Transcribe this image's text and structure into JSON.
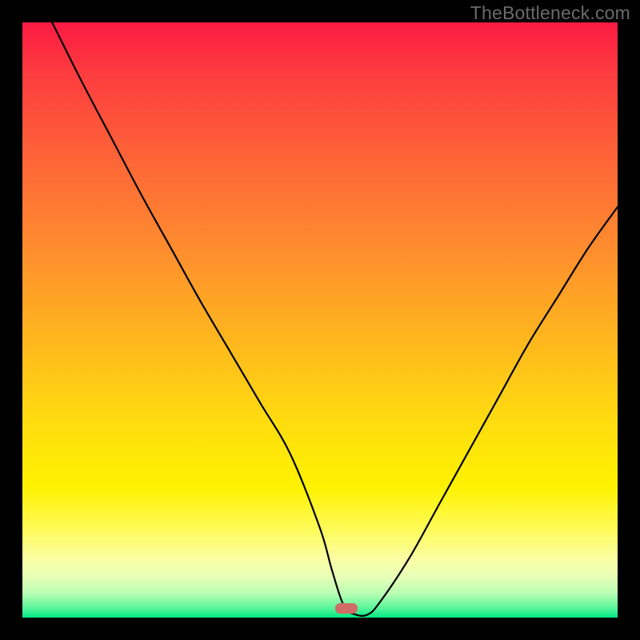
{
  "watermark": "TheBottleneck.com",
  "marker": {
    "x_pct": 54.5,
    "y_pct": 99.0
  },
  "chart_data": {
    "type": "line",
    "title": "",
    "xlabel": "",
    "ylabel": "",
    "xlim": [
      0,
      100
    ],
    "ylim": [
      0,
      100
    ],
    "grid": false,
    "annotations": [
      "TheBottleneck.com"
    ],
    "marker": {
      "x": 54.5,
      "y": 0.5
    },
    "series": [
      {
        "name": "bottleneck-curve",
        "x": [
          5,
          10,
          15,
          20,
          25,
          30,
          35,
          40,
          45,
          50,
          52,
          54,
          56,
          58,
          60,
          65,
          70,
          75,
          80,
          85,
          90,
          95,
          100
        ],
        "y": [
          100,
          90,
          80.5,
          71,
          62,
          53,
          44.5,
          36,
          27.5,
          15,
          8,
          2,
          0.5,
          0.5,
          2.5,
          10,
          19,
          28,
          37,
          46,
          54,
          62,
          69
        ]
      }
    ],
    "background_gradient_stops": [
      {
        "pos": 0.0,
        "color": "#fc1a44"
      },
      {
        "pos": 0.22,
        "color": "#fe6238"
      },
      {
        "pos": 0.52,
        "color": "#ffb31f"
      },
      {
        "pos": 0.78,
        "color": "#fff200"
      },
      {
        "pos": 0.93,
        "color": "#e9ffb6"
      },
      {
        "pos": 1.0,
        "color": "#00e884"
      }
    ]
  }
}
